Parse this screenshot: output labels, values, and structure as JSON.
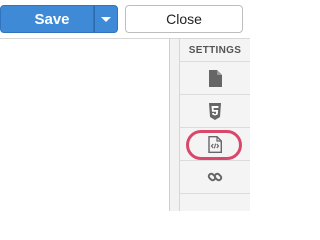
{
  "toolbar": {
    "save_label": "Save",
    "close_label": "Close",
    "accent_color": "#3f8ad6"
  },
  "sidebar": {
    "title": "SETTINGS",
    "items": [
      {
        "icon": "file-icon"
      },
      {
        "icon": "css3-icon"
      },
      {
        "icon": "code-file-icon",
        "highlighted": true
      },
      {
        "icon": "link-icon"
      }
    ],
    "highlight_color": "#d9486b"
  }
}
